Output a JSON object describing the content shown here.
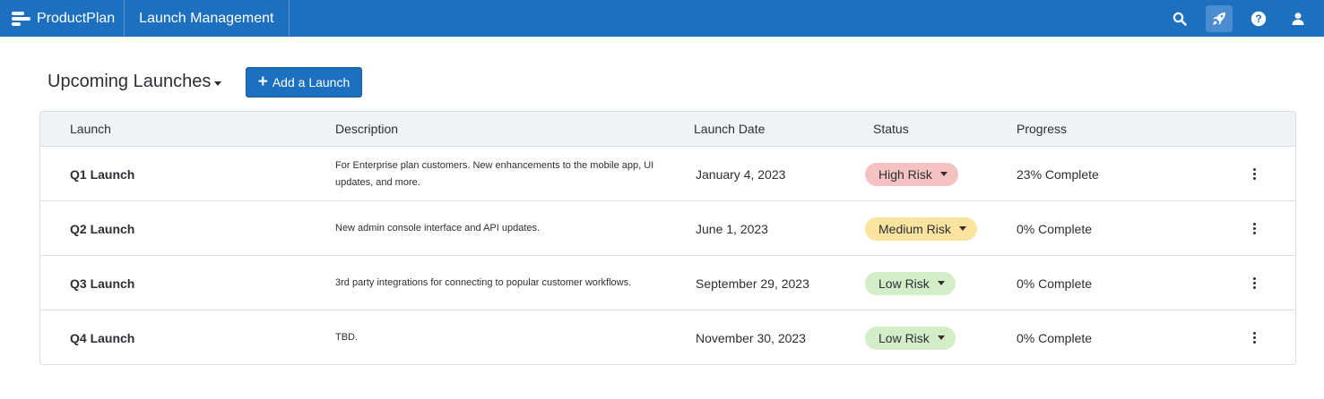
{
  "topbar": {
    "brand": "ProductPlan",
    "app": "Launch Management",
    "icons": [
      "search-icon",
      "rocket-icon",
      "help-icon",
      "user-icon"
    ],
    "active_icon": "rocket-icon",
    "bg_color": "#1d6fbf"
  },
  "header": {
    "view_title": "Upcoming Launches",
    "add_button": "Add a Launch"
  },
  "table": {
    "columns": [
      "Launch",
      "Description",
      "Launch Date",
      "Status",
      "Progress"
    ],
    "rows": [
      {
        "name": "Q1 Launch",
        "description": "For Enterprise plan customers. New enhancements to the mobile app, UI updates, and more.",
        "date": "January 4, 2023",
        "status": "High Risk",
        "status_color": "#f4c2c2",
        "progress": "23% Complete"
      },
      {
        "name": "Q2 Launch",
        "description": "New admin console interface and API updates.",
        "date": "June 1, 2023",
        "status": "Medium Risk",
        "status_color": "#fbe3a0",
        "progress": "0% Complete"
      },
      {
        "name": "Q3 Launch",
        "description": "3rd party integrations for connecting to popular customer workflows.",
        "date": "September 29, 2023",
        "status": "Low Risk",
        "status_color": "#d4edc9",
        "progress": "0% Complete"
      },
      {
        "name": "Q4 Launch",
        "description": "TBD.",
        "date": "November 30, 2023",
        "status": "Low Risk",
        "status_color": "#d4edc9",
        "progress": "0% Complete"
      }
    ]
  }
}
